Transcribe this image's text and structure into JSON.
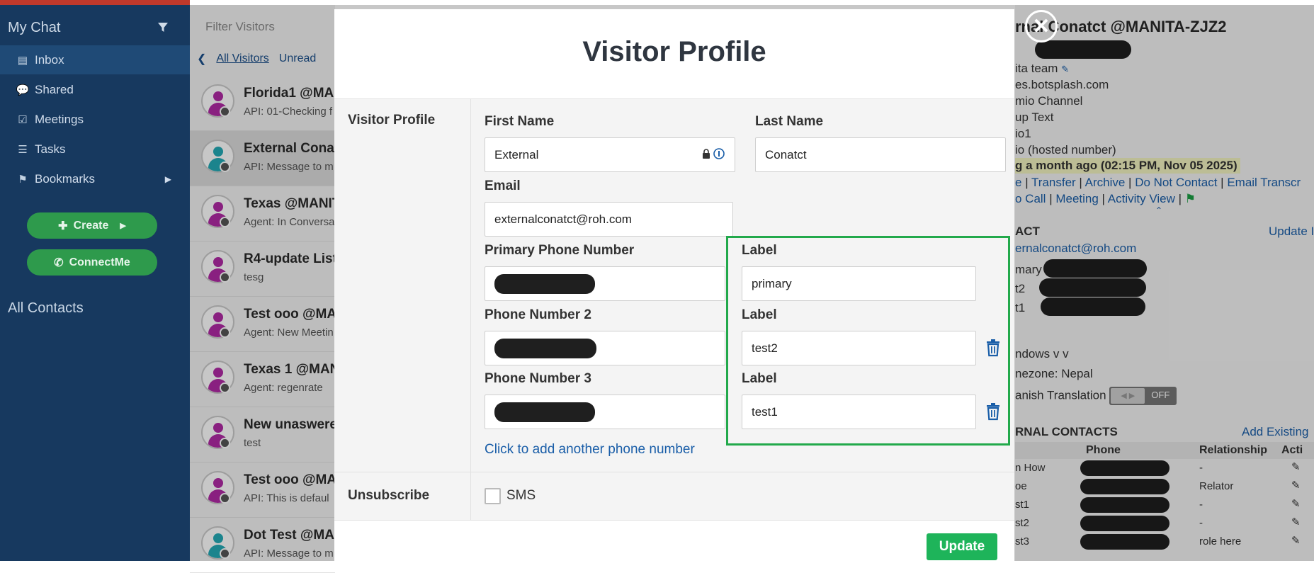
{
  "sidebar": {
    "title": "My Chat",
    "items": [
      {
        "label": "Inbox",
        "icon": "inbox-icon"
      },
      {
        "label": "Shared",
        "icon": "chat-bubbles-icon"
      },
      {
        "label": "Meetings",
        "icon": "calendar-icon"
      },
      {
        "label": "Tasks",
        "icon": "list-icon"
      },
      {
        "label": "Bookmarks",
        "icon": "bookmark-icon"
      }
    ],
    "create_label": "Create",
    "connect_label": "ConnectMe",
    "all_contacts": "All Contacts"
  },
  "visitors": {
    "filter_placeholder": "Filter Visitors",
    "tab_all": "All Visitors",
    "tab_unread": "Unread",
    "list": [
      {
        "name": "Florida1 @MA",
        "sub": "API: 01-Checking f",
        "color": "#b02aa4"
      },
      {
        "name": "External Conat",
        "sub": "API: Message to m",
        "color": "#23a9b5"
      },
      {
        "name": "Texas @MANIT",
        "sub": "Agent: In Conversa",
        "color": "#b02aa4"
      },
      {
        "name": "R4-update List",
        "sub": "tesg",
        "color": "#b02aa4"
      },
      {
        "name": "Test ooo @MA",
        "sub": "Agent: New Meetin",
        "color": "#b02aa4"
      },
      {
        "name": "Texas 1 @MAN",
        "sub": "Agent: regenrate",
        "color": "#b02aa4"
      },
      {
        "name": "New unaswere",
        "sub": "test",
        "color": "#b02aa4"
      },
      {
        "name": "Test ooo @MA",
        "sub": "API: This is defaul",
        "color": "#b02aa4"
      },
      {
        "name": "Dot Test @MA",
        "sub": "API: Message to m",
        "color": "#23a9b5"
      }
    ]
  },
  "right": {
    "name": "rnal Conatct @MANITA-ZJZ2",
    "team": "ita team",
    "site": "es.botsplash.com",
    "channel": "mio Channel",
    "text": "up Text",
    "io1": "io1",
    "hosted": "io (hosted number)",
    "highlight": "g a month ago (02:15 PM, Nov 05 2025)",
    "links1": [
      "e",
      "Transfer",
      "Archive",
      "Do Not Contact",
      "Email Transcr"
    ],
    "links2": [
      "o Call",
      "Meeting",
      "Activity View"
    ],
    "section": "ACT",
    "update": "Update I",
    "email": "ernalconatct@roh.com",
    "phones": [
      "mary",
      "t2",
      "t1"
    ],
    "windows": "ndows v v",
    "timezone": "nezone: Nepal",
    "translation": "anish Translation",
    "toggle_off": "OFF",
    "ext_title": "RNAL CONTACTS",
    "add_existing": "Add Existing",
    "table_headers": [
      "Phone",
      "Relationship",
      "Acti"
    ],
    "rows": [
      {
        "name": "n How",
        "rel": "-"
      },
      {
        "name": "oe",
        "rel": "Relator"
      },
      {
        "name": "st1",
        "rel": "-"
      },
      {
        "name": "st2",
        "rel": "-"
      },
      {
        "name": "st3",
        "rel": "role here"
      }
    ]
  },
  "modal": {
    "title": "Visitor Profile",
    "section_label": "Visitor Profile",
    "first_name_label": "First Name",
    "first_name": "External",
    "last_name_label": "Last Name",
    "last_name": "Conatct",
    "email_label": "Email",
    "email": "externalconatct@roh.com",
    "primary_phone_label": "Primary Phone Number",
    "phone2_label": "Phone Number 2",
    "phone3_label": "Phone Number 3",
    "label_title": "Label",
    "labels": [
      "primary",
      "test2",
      "test1"
    ],
    "add_phone": "Click to add another phone number",
    "unsubscribe_label": "Unsubscribe",
    "sms_label": "SMS",
    "update_label": "Update"
  },
  "colors": {
    "accent_green": "#22a94b",
    "sidebar_bg": "#17395f",
    "link": "#1a5ea8"
  }
}
